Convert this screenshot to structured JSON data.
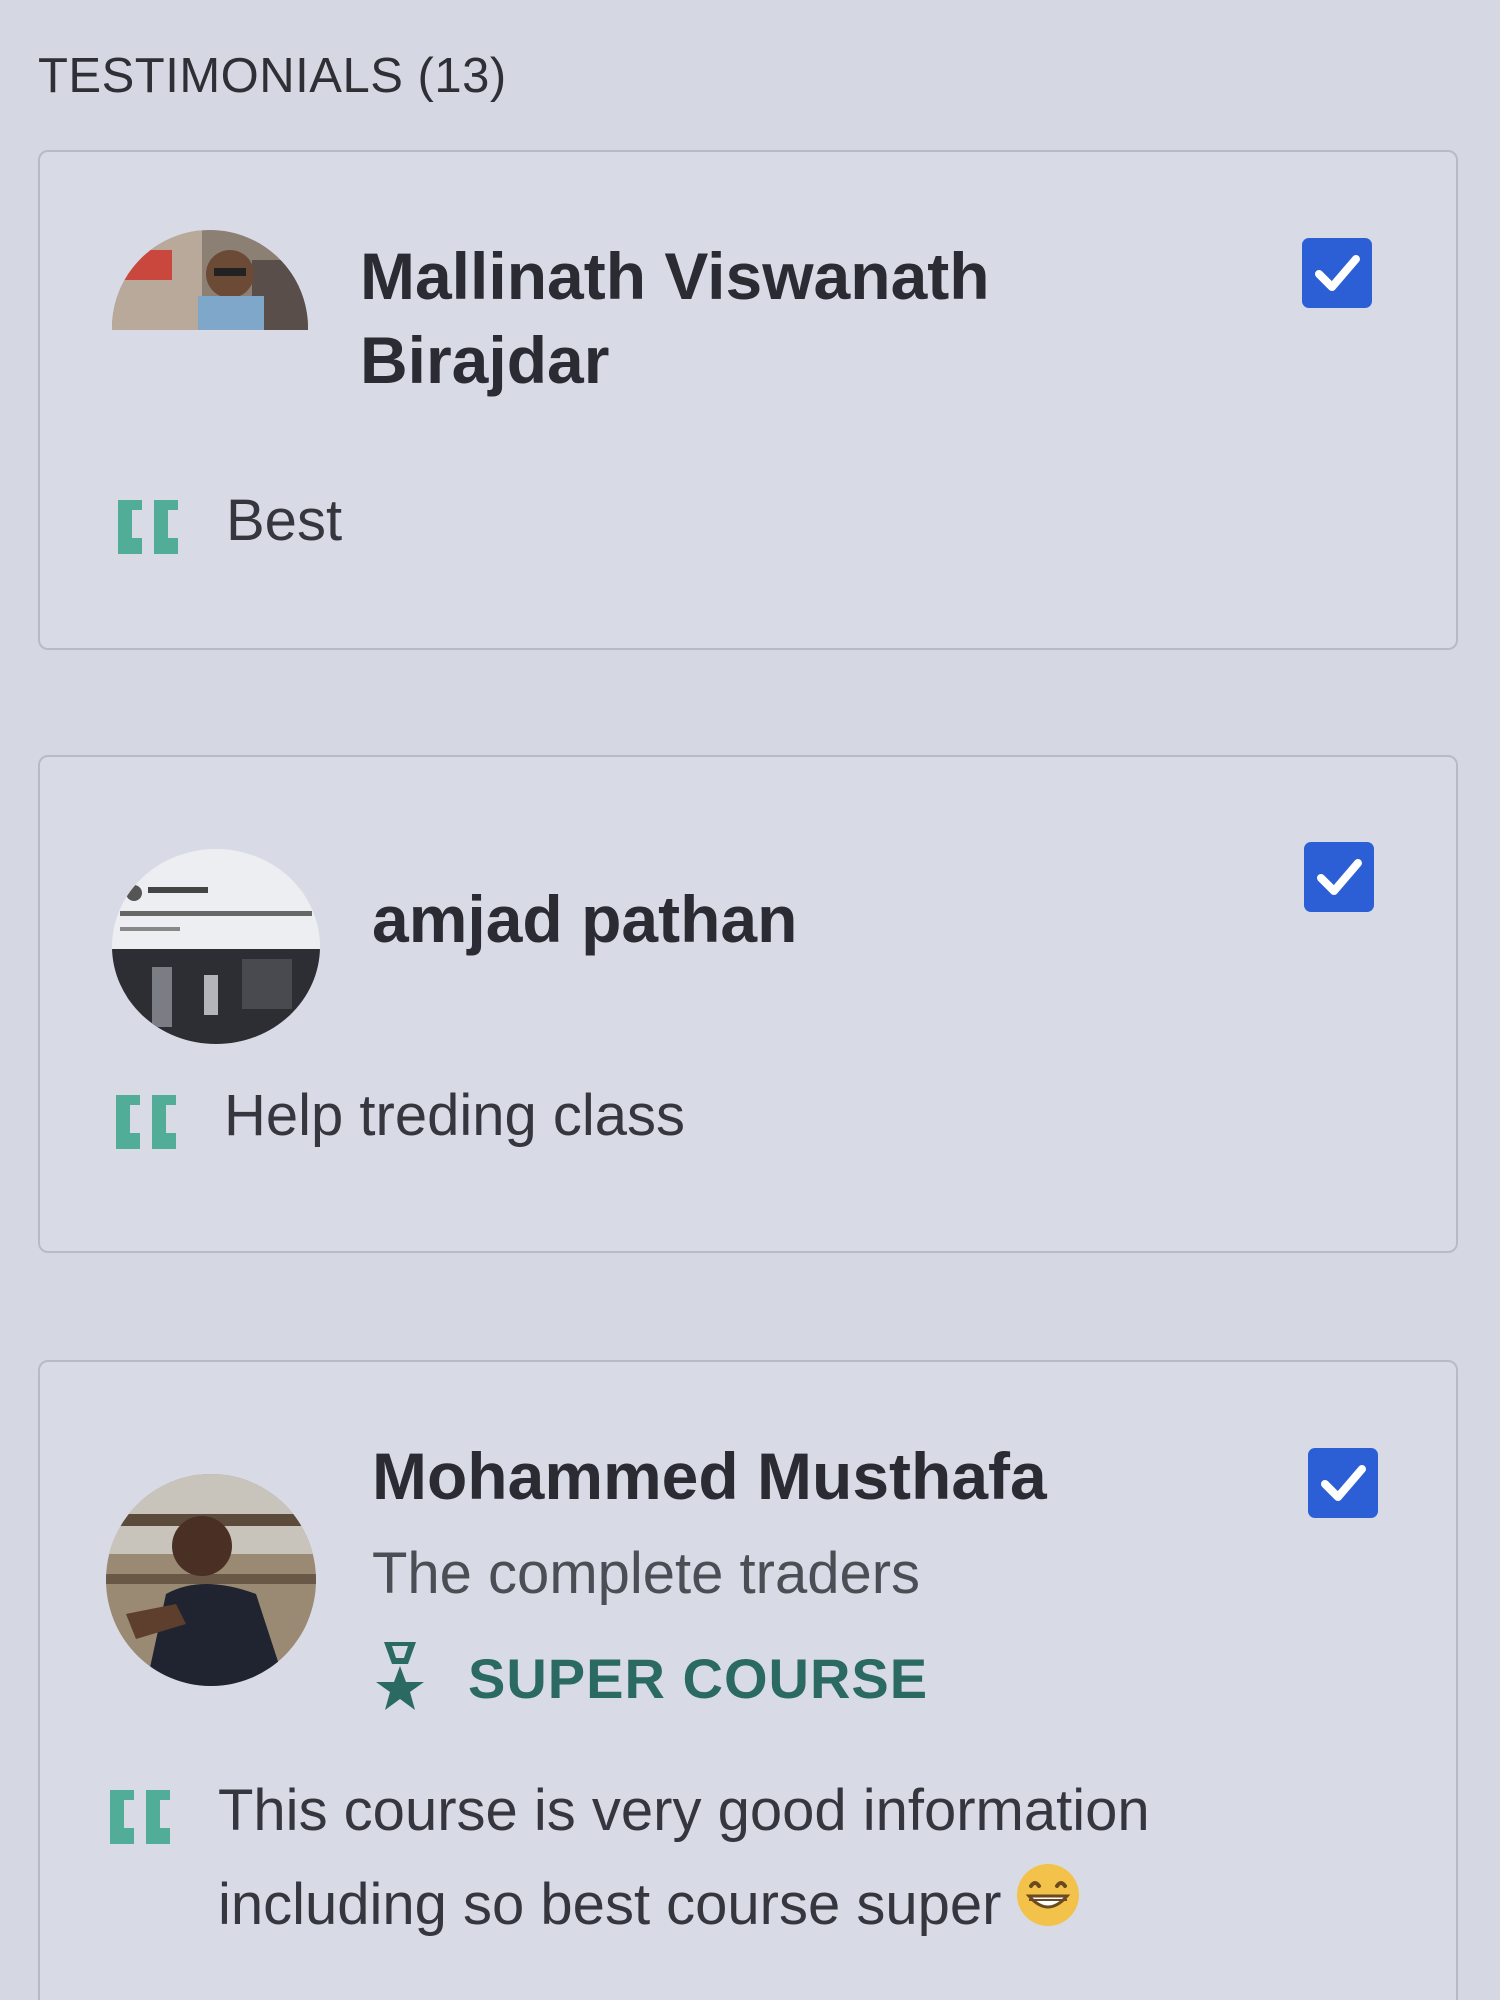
{
  "section": {
    "title": "TESTIMONIALS (13)"
  },
  "testimonials": [
    {
      "name": "Mallinath Viswanath Birajdar",
      "quote": "Best",
      "selected": true
    },
    {
      "name": "amjad pathan",
      "quote": "Help treding class",
      "selected": true
    },
    {
      "name": "Mohammed Musthafa",
      "subtitle": "The complete traders",
      "badge": "SUPER COURSE",
      "quote": "This course is very good information including so best course super",
      "selected": true
    }
  ],
  "colors": {
    "background": "#d5d8e2",
    "checkbox": "#2c5fd6",
    "quote_icon": "#3aa58a",
    "badge": "#2b6a63"
  },
  "icons": {
    "quote": "quote-icon",
    "checkbox": "checkmark-icon",
    "badge": "award-ribbon-icon",
    "emoji": "grinning-face-emoji"
  }
}
